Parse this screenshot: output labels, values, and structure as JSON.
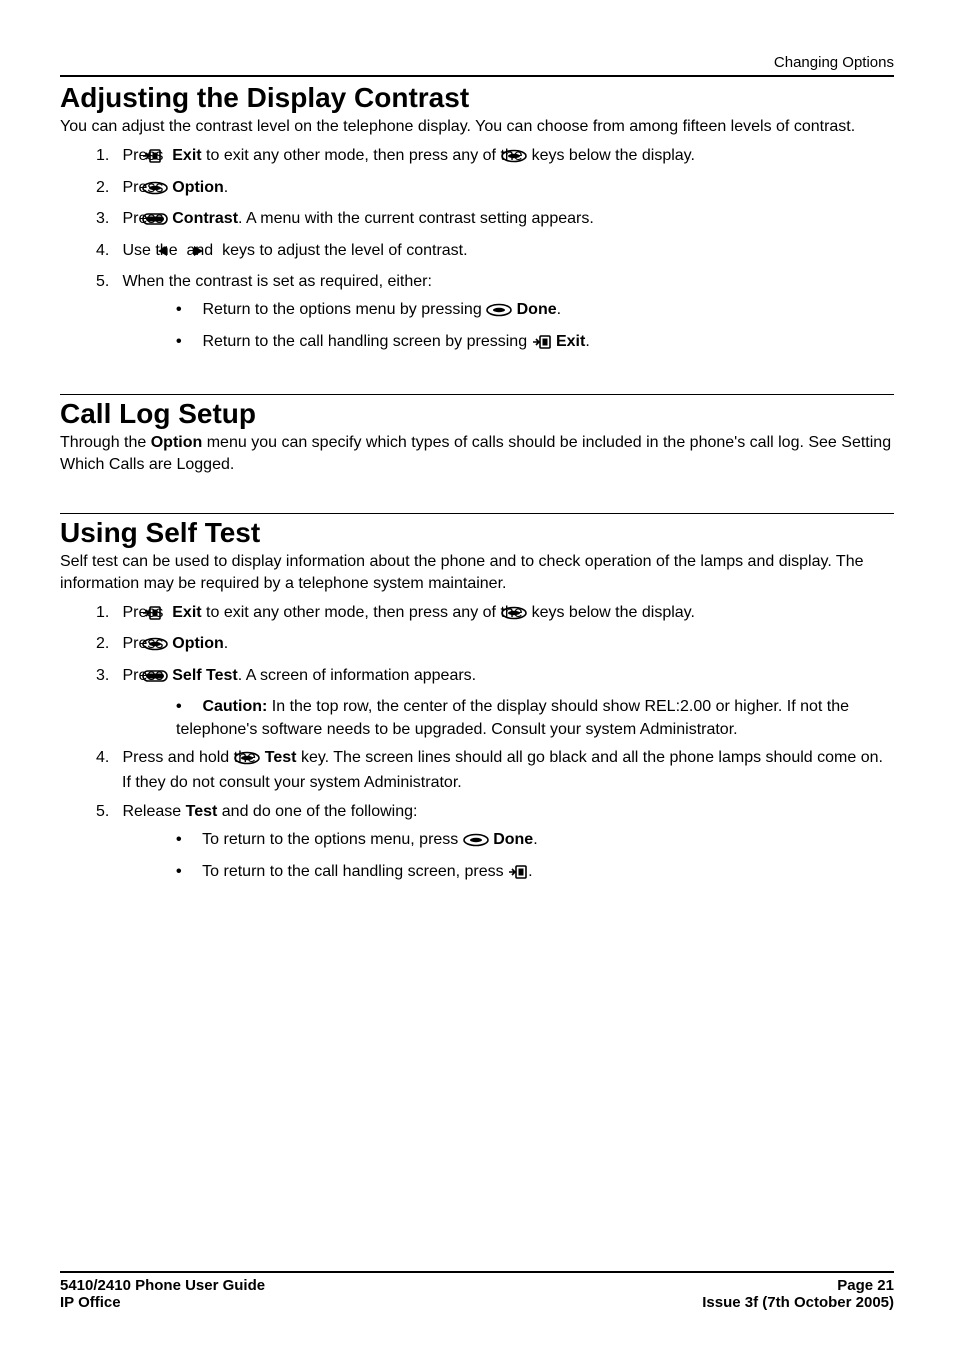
{
  "header": {
    "running": "Changing Options"
  },
  "sec1": {
    "title": "Adjusting the Display Contrast",
    "lead": "You can adjust the contrast level on the telephone display. You can choose from among fifteen levels of contrast.",
    "s1a": "Press ",
    "s1b": " Exit",
    "s1c": " to exit any other mode, then press any of the ",
    "s1d": " keys below the display.",
    "s2a": "Press ",
    "s2b": " Option",
    "s2c": ".",
    "s3a": "Press ",
    "s3b": " Contrast",
    "s3c": ". A menu with the current contrast setting appears.",
    "s4a": "Use the ",
    "s4b": " and ",
    "s4c": " keys to adjust the level of contrast.",
    "s5": "When the contrast is set as required, either:",
    "s5_1a": "Return to the options menu by pressing ",
    "s5_1b": " Done",
    "s5_1c": ".",
    "s5_2a": "Return to the call handling screen by pressing ",
    "s5_2b": " Exit",
    "s5_2c": "."
  },
  "sec2": {
    "title": "Call Log Setup",
    "lead_a": "Through the ",
    "lead_b": "Option",
    "lead_c": " menu you can specify which types of calls should be included in the phone's call log. See Setting Which Calls are Logged."
  },
  "sec3": {
    "title": "Using Self Test",
    "lead": "Self test can be used to display information about the phone and to check operation of the lamps and display. The information may be required by a telephone system maintainer.",
    "s1a": "Press ",
    "s1b": " Exit",
    "s1c": " to exit any other mode, then press any of the ",
    "s1d": " keys below the display.",
    "s2a": "Press ",
    "s2b": " Option",
    "s2c": ".",
    "s3a": "Press ",
    "s3b": " Self Test",
    "s3c": ". A screen of information appears.",
    "s3_1a": "Caution:",
    "s3_1b": "  In the top row, the center of the display should show REL:2.00 or higher. If not the telephone's software needs to be upgraded. Consult your system Administrator.",
    "s4a": "Press and hold the ",
    "s4b": " Test",
    "s4c": " key. The screen lines should all go black and all the phone lamps should come on. If they do not consult your system Administrator.",
    "s5a": "Release ",
    "s5b": "Test",
    "s5c": " and do one of the following:",
    "s5_1a": "To return to the options menu, press ",
    "s5_1b": " Done",
    "s5_1c": ".",
    "s5_2a": "To return to the call handling screen, press ",
    "s5_2c": "."
  },
  "footer": {
    "tl": "5410/2410 Phone User Guide",
    "tr": "Page 21",
    "bl": "IP Office",
    "br": "Issue 3f (7th October 2005)"
  }
}
